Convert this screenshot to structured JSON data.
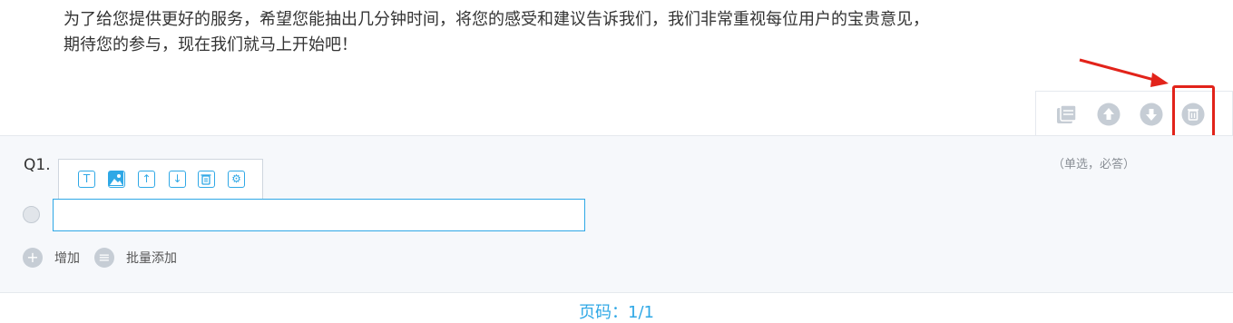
{
  "intro": {
    "line1": "为了给您提供更好的服务，希望您能抽出几分钟时间，将您的感受和建议告诉我们，我们非常重视每位用户的宝贵意见，",
    "line2": "期待您的参与，现在我们就马上开始吧！"
  },
  "toolbar": {
    "icons": [
      "copy-icon",
      "move-up-icon",
      "move-down-icon",
      "delete-icon"
    ]
  },
  "question": {
    "number": "Q1.",
    "hint": "（单选，必答）",
    "option_value": "",
    "mini_toolbar": [
      "T",
      "image",
      "↑",
      "↓",
      "delete",
      "settings"
    ]
  },
  "actions": {
    "add_label": "增加",
    "batch_add_label": "批量添加"
  },
  "footer": {
    "page_label": "页码：1/1"
  },
  "colors": {
    "accent": "#2fa8e6",
    "highlight": "#e2231a",
    "icon_gray": "#c6cdd5"
  }
}
